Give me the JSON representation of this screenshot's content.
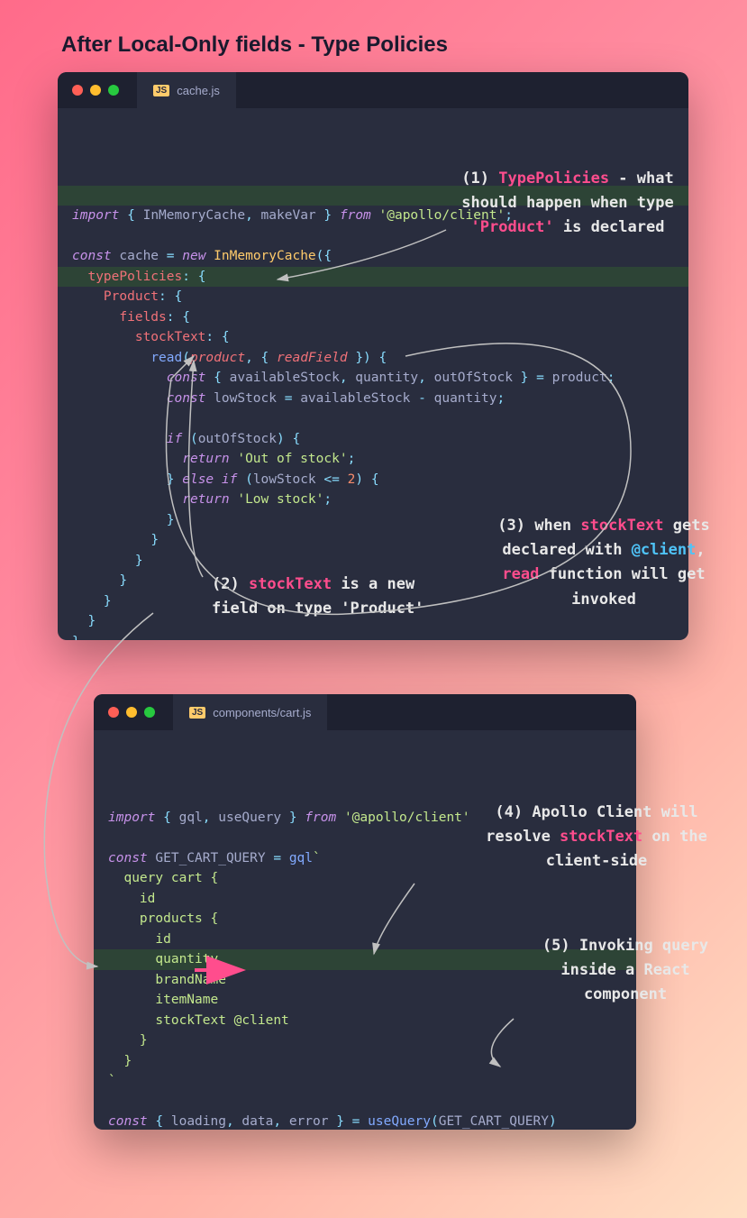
{
  "title": "After Local-Only fields - Type Policies",
  "window1": {
    "filename": "cache.js",
    "code_html": "<span class=\"kw\">import</span> <span class=\"punc\">{</span> InMemoryCache<span class=\"punc\">,</span> makeVar <span class=\"punc\">}</span> <span class=\"kw\">from</span> <span class=\"str\">'@apollo/client'</span><span class=\"punc\">;</span>\n\n<span class=\"kw\">const</span> cache <span class=\"op\">=</span> <span class=\"kw\">new</span> <span class=\"cls\">InMemoryCache</span><span class=\"punc\">({</span>\n  <span class=\"propkey\">typePolicies</span><span class=\"punc\">:</span> <span class=\"punc\">{</span>\n    <span class=\"propkey\">Product</span><span class=\"punc\">:</span> <span class=\"punc\">{</span>\n      <span class=\"propkey\">fields</span><span class=\"punc\">:</span> <span class=\"punc\">{</span>\n        <span class=\"propkey\">stockText</span><span class=\"punc\">:</span> <span class=\"punc\">{</span>\n          <span class=\"fn\">read</span><span class=\"punc\">(</span><span class=\"prm\">product</span><span class=\"punc\">,</span> <span class=\"punc\">{</span> <span class=\"prm\">readField</span> <span class=\"punc\">})</span> <span class=\"punc\">{</span>\n            <span class=\"kw\">const</span> <span class=\"punc\">{</span> availableStock<span class=\"punc\">,</span> quantity<span class=\"punc\">,</span> outOfStock <span class=\"punc\">}</span> <span class=\"op\">=</span> product<span class=\"punc\">;</span>\n            <span class=\"kw\">const</span> lowStock <span class=\"op\">=</span> availableStock <span class=\"op\">-</span> quantity<span class=\"punc\">;</span>\n\n            <span class=\"kw\">if</span> <span class=\"punc\">(</span>outOfStock<span class=\"punc\">)</span> <span class=\"punc\">{</span>\n              <span class=\"kw\">return</span> <span class=\"str\">'Out of stock'</span><span class=\"punc\">;</span>\n            <span class=\"punc\">}</span> <span class=\"kw\">else</span> <span class=\"kw\">if</span> <span class=\"punc\">(</span>lowStock <span class=\"op\">&lt;=</span> <span class=\"num\">2</span><span class=\"punc\">)</span> <span class=\"punc\">{</span>\n              <span class=\"kw\">return</span> <span class=\"str\">'Low stock'</span><span class=\"punc\">;</span>\n            <span class=\"punc\">}</span>\n          <span class=\"punc\">}</span>\n        <span class=\"punc\">}</span>\n      <span class=\"punc\">}</span>\n    <span class=\"punc\">}</span>\n  <span class=\"punc\">}</span>\n<span class=\"punc\">}</span>\n\n<span class=\"kw\">const</span> client <span class=\"op\">=</span> <span class=\"kw\">new</span> <span class=\"cls\">ApolloClient</span><span class=\"punc\">({</span> cache <span class=\"punc\">});</span>"
  },
  "window2": {
    "filename": "components/cart.js",
    "code_html": "<span class=\"kw\">import</span> <span class=\"punc\">{</span> gql<span class=\"punc\">,</span> useQuery <span class=\"punc\">}</span> <span class=\"kw\">from</span> <span class=\"str\">'@apollo/client'</span>\n\n<span class=\"kw\">const</span> GET_CART_QUERY <span class=\"op\">=</span> <span class=\"fn\">gql</span><span class=\"str\">`</span>\n<span class=\"str\">  query cart {</span>\n<span class=\"str\">    id</span>\n<span class=\"str\">    products {</span>\n<span class=\"str\">      id</span>\n<span class=\"str\">      quantity</span>\n<span class=\"str\">      brandName</span>\n<span class=\"str\">      itemName</span>\n<span class=\"str\">      stockText @client</span>\n<span class=\"str\">    }</span>\n<span class=\"str\">  }</span>\n<span class=\"str\">`</span>\n\n<span class=\"kw\">const</span> <span class=\"punc\">{</span> loading<span class=\"punc\">,</span> data<span class=\"punc\">,</span> error <span class=\"punc\">}</span> <span class=\"op\">=</span> <span class=\"fn\">useQuery</span><span class=\"punc\">(</span>GET_CART_QUERY<span class=\"punc\">)</span>"
  },
  "annotations": {
    "a1": "(1) <span class=\"pink\">TypePolicies</span> - what should happen when type <span class=\"pink\">'Product'</span> is declared",
    "a2": "(2) <span class=\"pink\">stockText</span> is a new field on type 'Product'",
    "a3": "(3) when <span class=\"pink\">stockText</span> gets declared with <span class=\"blue\">@client</span>, <span class=\"pink\">read</span> function will get invoked",
    "a4": "(4) Apollo Client will resolve <span class=\"pink\">stockText</span> on the client-side",
    "a5": "(5) Invoking query inside a React component"
  }
}
